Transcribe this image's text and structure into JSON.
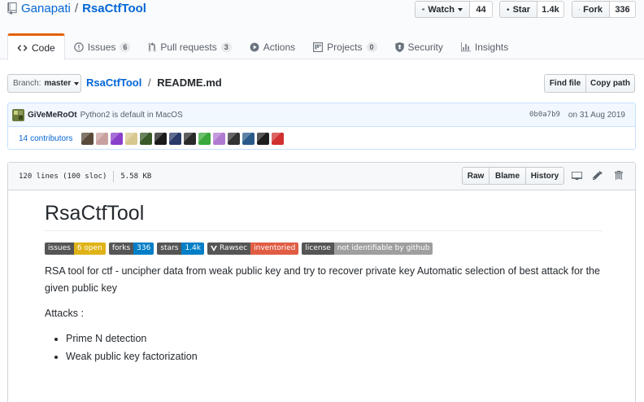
{
  "repo": {
    "owner": "Ganapati",
    "separator": "/",
    "name": "RsaCtfTool"
  },
  "social": {
    "watch": {
      "label": "Watch",
      "count": "44"
    },
    "star": {
      "label": "Star",
      "count": "1.4k"
    },
    "fork": {
      "label": "Fork",
      "count": "336"
    }
  },
  "tabs": [
    {
      "label": "Code",
      "count": null,
      "icon": "code-icon"
    },
    {
      "label": "Issues",
      "count": "6",
      "icon": "issue-icon"
    },
    {
      "label": "Pull requests",
      "count": "3",
      "icon": "pull-request-icon"
    },
    {
      "label": "Actions",
      "count": null,
      "icon": "play-icon"
    },
    {
      "label": "Projects",
      "count": "0",
      "icon": "project-icon"
    },
    {
      "label": "Security",
      "count": null,
      "icon": "shield-icon"
    },
    {
      "label": "Insights",
      "count": null,
      "icon": "graph-icon"
    }
  ],
  "filenav": {
    "branch_label": "Branch:",
    "branch_value": "master",
    "crumb_repo": "RsaCtfTool",
    "crumb_sep": "/",
    "crumb_file": "README.md",
    "find_file": "Find file",
    "copy_path": "Copy path"
  },
  "commit": {
    "author": "GiVeMeRoOt",
    "message": "Python2 is default in MacOS",
    "sha": "0b0a7b9",
    "date": "on 31 Aug 2019",
    "contributors_count": "14",
    "contributors_label": "contributors",
    "avatar_colors": [
      "#5a4a3a",
      "#c9a0a0",
      "#8a3fc9",
      "#d8c890",
      "#3a5a2a",
      "#1a1a1a",
      "#2a3a6a",
      "#2a2a2a",
      "#3aa83a",
      "#b07ad0",
      "#333333",
      "#2a5a8a",
      "#1e1e1e",
      "#d03030"
    ]
  },
  "file": {
    "lines": "120 lines (100 sloc)",
    "size": "5.58 KB",
    "raw": "Raw",
    "blame": "Blame",
    "history": "History"
  },
  "readme": {
    "title": "RsaCtfTool",
    "badges": [
      {
        "left": "issues",
        "right": "6 open",
        "color": "#dfb317"
      },
      {
        "left": "forks",
        "right": "336",
        "color": "#007ec6"
      },
      {
        "left": "stars",
        "right": "1.4k",
        "color": "#007ec6"
      },
      {
        "left": "Rawsec",
        "right": "inventoried",
        "color": "#e05d44"
      },
      {
        "left": "license",
        "right": "not identifiable by github",
        "color": "#9f9f9f"
      }
    ],
    "description": "RSA tool for ctf - uncipher data from weak public key and try to recover private key Automatic selection of best attack for the given public key",
    "attacks_heading": "Attacks :",
    "attacks": [
      "Prime N detection",
      "Weak public key factorization"
    ]
  }
}
